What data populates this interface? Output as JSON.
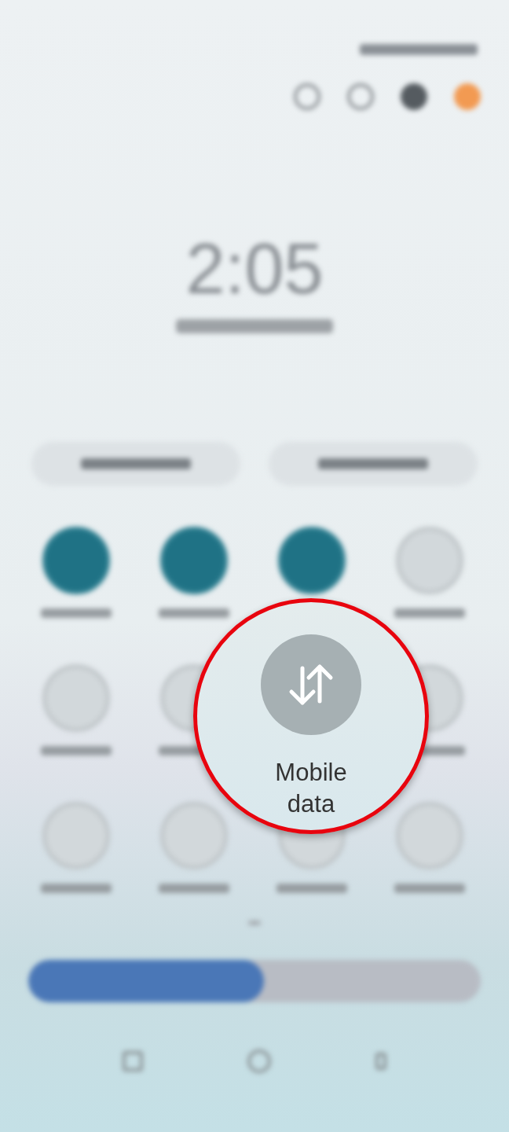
{
  "clock": {
    "time": "2:05"
  },
  "quick_tiles": [
    {
      "kind": "tile",
      "on": true
    },
    {
      "kind": "tile",
      "on": true
    },
    {
      "kind": "tile",
      "on": true
    },
    {
      "kind": "tile",
      "on": false
    },
    {
      "kind": "tile",
      "on": false
    },
    {
      "kind": "tile",
      "on": false
    },
    {
      "kind": "magnified",
      "label": "Mobile data",
      "on": false
    },
    {
      "kind": "tile",
      "on": false
    },
    {
      "kind": "tile",
      "on": false
    },
    {
      "kind": "tile",
      "on": false
    },
    {
      "kind": "tile",
      "on": false
    },
    {
      "kind": "tile",
      "on": false
    }
  ],
  "brightness": {
    "level": 0.52
  }
}
